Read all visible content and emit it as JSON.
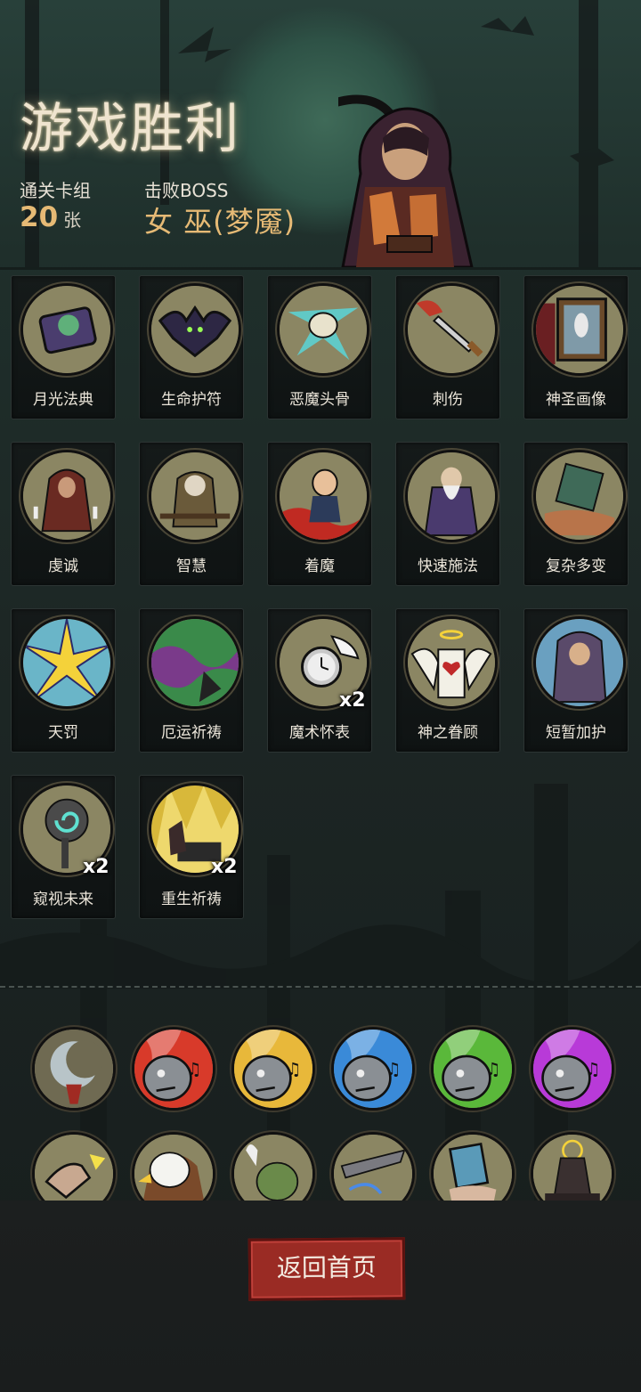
{
  "screen": {
    "title": "游戏胜利",
    "deck_label": "通关卡组",
    "deck_count": "20",
    "deck_unit": "张",
    "boss_label": "击败BOSS",
    "boss_name": "女 巫(梦魇)"
  },
  "cards": [
    {
      "name": "月光法典",
      "icon": "moon-tome-icon",
      "mult": ""
    },
    {
      "name": "生命护符",
      "icon": "bat-amulet-icon",
      "mult": ""
    },
    {
      "name": "恶魔头骨",
      "icon": "demon-skull-icon",
      "mult": ""
    },
    {
      "name": "刺伤",
      "icon": "dagger-icon",
      "mult": ""
    },
    {
      "name": "神圣画像",
      "icon": "holy-portrait-icon",
      "mult": ""
    },
    {
      "name": "虔诚",
      "icon": "praying-figure-icon",
      "mult": ""
    },
    {
      "name": "智慧",
      "icon": "sage-icon",
      "mult": ""
    },
    {
      "name": "着魔",
      "icon": "possessed-man-icon",
      "mult": ""
    },
    {
      "name": "快速施法",
      "icon": "wizard-icon",
      "mult": ""
    },
    {
      "name": "复杂多变",
      "icon": "cube-hand-icon",
      "mult": ""
    },
    {
      "name": "天罚",
      "icon": "lightning-burst-icon",
      "mult": ""
    },
    {
      "name": "厄运祈祷",
      "icon": "green-smoke-icon",
      "mult": ""
    },
    {
      "name": "魔术怀表",
      "icon": "pocket-watch-icon",
      "mult": "x2"
    },
    {
      "name": "神之眷顾",
      "icon": "angel-heart-icon",
      "mult": ""
    },
    {
      "name": "短暂加护",
      "icon": "hooded-mage-icon",
      "mult": ""
    },
    {
      "name": "窥视未来",
      "icon": "swirl-orb-icon",
      "mult": "x2"
    },
    {
      "name": "重生祈祷",
      "icon": "golden-rebirth-icon",
      "mult": "x2"
    }
  ],
  "relics": [
    {
      "icon": "crescent-moon-icon"
    },
    {
      "icon": "gargoyle-red-flame-icon"
    },
    {
      "icon": "gargoyle-gold-flame-icon"
    },
    {
      "icon": "gargoyle-blue-flame-icon"
    },
    {
      "icon": "gargoyle-green-flame-icon"
    },
    {
      "icon": "gargoyle-purple-flame-icon"
    },
    {
      "icon": "snapping-hand-icon"
    },
    {
      "icon": "eagle-icon"
    },
    {
      "icon": "goblin-ghost-icon"
    },
    {
      "icon": "slashing-hand-icon"
    },
    {
      "icon": "card-hand-icon"
    },
    {
      "icon": "monk-altar-icon"
    }
  ],
  "actions": {
    "home_button": "返回首页"
  },
  "colors": {
    "accent_gold": "#e6ba75",
    "button_red": "#9a2b24",
    "title_text": "#efe4cf"
  }
}
